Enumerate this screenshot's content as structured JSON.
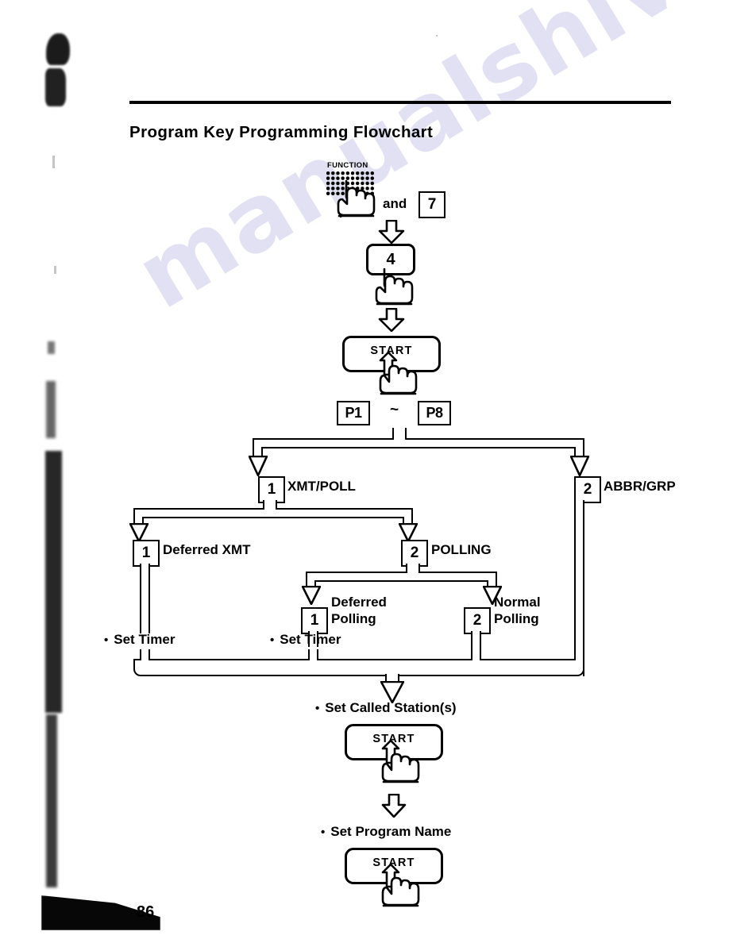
{
  "document": {
    "page_number": "86",
    "title": "Program Key Programming Flowchart",
    "watermark": "manualshive.com"
  },
  "chart_data": {
    "type": "diagram",
    "title": "Program Key Programming Flowchart",
    "nodes": [
      {
        "id": "function_key",
        "label": "FUNCTION",
        "kind": "dot-matrix-key"
      },
      {
        "id": "and",
        "label": "and",
        "kind": "text"
      },
      {
        "id": "key_7",
        "label": "7",
        "kind": "boxed-key"
      },
      {
        "id": "key_4",
        "label": "4",
        "kind": "rounded-key"
      },
      {
        "id": "start_1",
        "label": "START",
        "kind": "start-key"
      },
      {
        "id": "p1",
        "label": "P1",
        "kind": "boxed-key"
      },
      {
        "id": "tilde",
        "label": "~",
        "kind": "text"
      },
      {
        "id": "p8",
        "label": "P8",
        "kind": "boxed-key"
      },
      {
        "id": "opt_1_xmtpoll",
        "label": "1",
        "text": "XMT/POLL",
        "kind": "boxed-key-label"
      },
      {
        "id": "opt_2_abbrgrp",
        "label": "2",
        "text": "ABBR/GRP",
        "kind": "boxed-key-label"
      },
      {
        "id": "opt_1_deferred_xmt",
        "label": "1",
        "text": "Deferred XMT",
        "kind": "boxed-key-label"
      },
      {
        "id": "opt_2_polling",
        "label": "2",
        "text": "POLLING",
        "kind": "boxed-key-label"
      },
      {
        "id": "opt_1_deferred_polling",
        "label": "1",
        "text": "Deferred Polling",
        "kind": "boxed-key-label"
      },
      {
        "id": "opt_2_normal_polling",
        "label": "2",
        "text": "Normal Polling",
        "kind": "boxed-key-label"
      },
      {
        "id": "set_timer_1",
        "label": "Set Timer",
        "kind": "bullet"
      },
      {
        "id": "set_timer_2",
        "label": "Set Timer",
        "kind": "bullet"
      },
      {
        "id": "set_called_stations",
        "label": "Set Called Station(s)",
        "kind": "bullet"
      },
      {
        "id": "start_2",
        "label": "START",
        "kind": "start-key"
      },
      {
        "id": "set_program_name",
        "label": "Set Program Name",
        "kind": "bullet"
      },
      {
        "id": "start_3",
        "label": "START",
        "kind": "start-key"
      }
    ],
    "edges": [
      {
        "from": "function_key",
        "to": "key_4"
      },
      {
        "from": "key_4",
        "to": "start_1"
      },
      {
        "from": "start_1",
        "to": "p1"
      },
      {
        "from": "p1",
        "to": "opt_1_xmtpoll"
      },
      {
        "from": "p1",
        "to": "opt_2_abbrgrp"
      },
      {
        "from": "opt_1_xmtpoll",
        "to": "opt_1_deferred_xmt"
      },
      {
        "from": "opt_1_xmtpoll",
        "to": "opt_2_polling"
      },
      {
        "from": "opt_2_polling",
        "to": "opt_1_deferred_polling"
      },
      {
        "from": "opt_2_polling",
        "to": "opt_2_normal_polling"
      },
      {
        "from": "opt_1_deferred_xmt",
        "to": "set_timer_1"
      },
      {
        "from": "opt_1_deferred_polling",
        "to": "set_timer_2"
      },
      {
        "from": "set_timer_1",
        "to": "set_called_stations"
      },
      {
        "from": "set_timer_2",
        "to": "set_called_stations"
      },
      {
        "from": "opt_2_normal_polling",
        "to": "set_called_stations"
      },
      {
        "from": "opt_2_abbrgrp",
        "to": "set_called_stations"
      },
      {
        "from": "set_called_stations",
        "to": "start_2"
      },
      {
        "from": "start_2",
        "to": "set_program_name"
      },
      {
        "from": "set_program_name",
        "to": "start_3"
      }
    ]
  },
  "flow": {
    "function_key_caption": "FUNCTION",
    "and_text": "and",
    "key_7": "7",
    "key_4": "4",
    "start_label_1": "START",
    "p1": "P1",
    "tilde": "~",
    "p8": "P8",
    "opt1_num": "1",
    "opt1_text": "XMT/POLL",
    "opt2_num": "2",
    "opt2_text": "ABBR/GRP",
    "deferred_xmt_num": "1",
    "deferred_xmt_text": "Deferred XMT",
    "polling_num": "2",
    "polling_text": "POLLING",
    "deferred_polling_num": "1",
    "deferred_polling_line1": "Deferred",
    "deferred_polling_line2": "Polling",
    "normal_polling_num": "2",
    "normal_polling_line1": "Normal",
    "normal_polling_line2": "Polling",
    "set_timer_left": "Set Timer",
    "set_timer_mid": "Set Timer",
    "set_called_stations": "Set Called Station(s)",
    "start_label_2": "START",
    "set_program_name": "Set Program Name",
    "start_label_3": "START"
  }
}
